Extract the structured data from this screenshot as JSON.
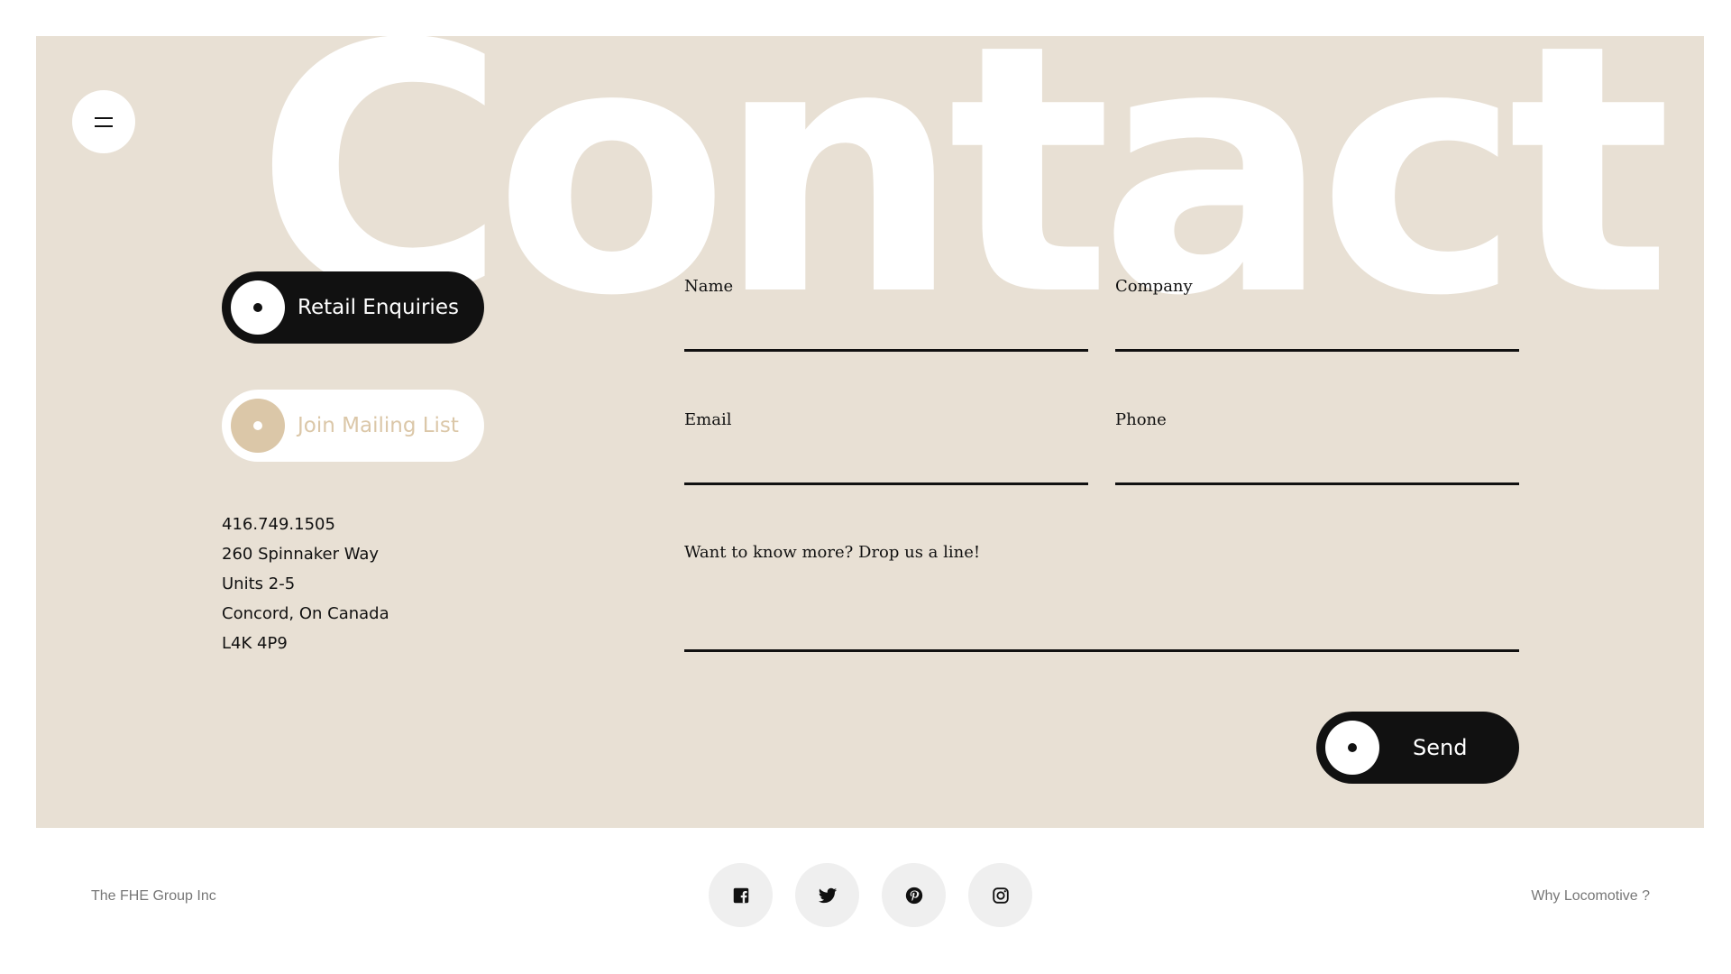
{
  "hero": {
    "title": "Contact"
  },
  "pills": {
    "retail": "Retail Enquiries",
    "mailing": "Join Mailing List"
  },
  "address": {
    "phone": "416.749.1505",
    "street": "260 Spinnaker Way",
    "units": "Units 2-5",
    "city": "Concord, On Canada",
    "postal": "L4K 4P9"
  },
  "form": {
    "name_label": "Name",
    "company_label": "Company",
    "email_label": "Email",
    "phone_label": "Phone",
    "message_label": "Want to know more? Drop us a line!",
    "send_label": "Send"
  },
  "footer": {
    "company": "The FHE Group Inc",
    "link": "Why Locomotive ?",
    "socials": [
      "facebook-icon",
      "twitter-icon",
      "pinterest-icon",
      "instagram-icon"
    ]
  },
  "colors": {
    "panel": "#e8e0d4",
    "dark": "#111111",
    "accent": "#dbc7a8",
    "social_bg": "#efefef"
  }
}
